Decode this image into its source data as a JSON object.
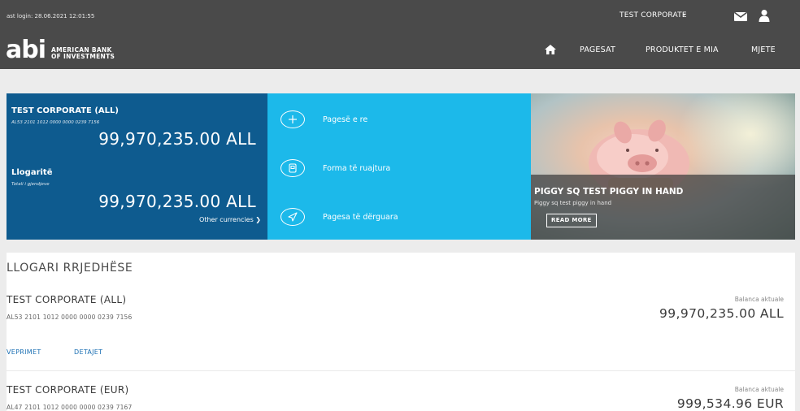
{
  "header": {
    "last_login": "ast login: 28.06.2021 12:01:55",
    "user_menu": "TEST CORPORATE",
    "logo_mark": "abi",
    "logo_line1": "AMERICAN BANK",
    "logo_line2": "OF INVESTMENTS",
    "nav": [
      "PAGESAT",
      "PRODUKTET E MIA",
      "MJETE"
    ],
    "icons": [
      "home-icon",
      "mail-icon",
      "user-icon",
      "chevron-down-icon"
    ]
  },
  "account_panel": {
    "title": "TEST CORPORATE (ALL)",
    "iban": "AL53 2101 1012 0000 0000 0239 7156",
    "amount": "99,970,235.00 ALL",
    "accounts_title": "Llogaritë",
    "accounts_note": "Totali i gjendjeve",
    "accounts_amount": "99,970,235.00 ALL",
    "other_currencies": "Other currencies"
  },
  "quick_actions": [
    {
      "label": "Pagesë e re",
      "icon": "plus-circle-icon"
    },
    {
      "label": "Forma të ruajtura",
      "icon": "saved-form-icon"
    },
    {
      "label": "Pagesa të dërguara",
      "icon": "send-icon"
    }
  ],
  "promo": {
    "title": "PIGGY SQ TEST PIGGY IN HAND",
    "subtitle": "Piggy sq test piggy in hand",
    "button": "READ MORE"
  },
  "accounts_list": {
    "section_title": "LLOGARI RRJEDHËSE",
    "rows": [
      {
        "name": "TEST CORPORATE (ALL)",
        "iban": "AL53 2101 1012 0000 0000 0239 7156",
        "balance_label": "Balanca aktuale",
        "balance": "99,970,235.00 ALL",
        "links": [
          "VEPRIMET",
          "DETAJET"
        ]
      },
      {
        "name": "TEST CORPORATE (EUR)",
        "iban": "AL47 2101 1012 0000 0000 0239 7167",
        "balance_label": "Balanca aktuale",
        "balance": "999,534.96 EUR"
      }
    ]
  },
  "colors": {
    "topbar": "#4a4a4a",
    "account_panel": "#0e5b8f",
    "quick_actions": "#1cb9ea",
    "link": "#1a6fb3"
  }
}
